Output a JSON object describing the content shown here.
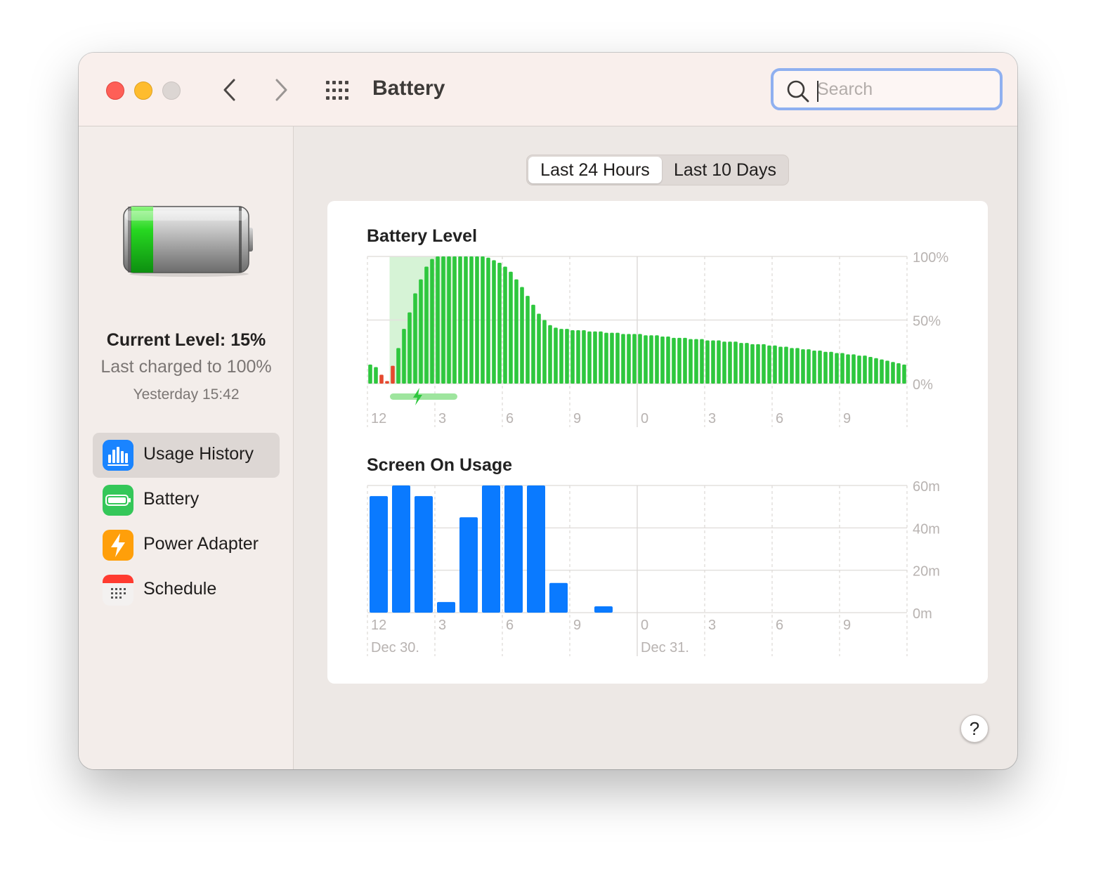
{
  "window": {
    "title": "Battery"
  },
  "search": {
    "placeholder": "Search",
    "value": ""
  },
  "sidebar": {
    "current_level": "Current Level: 15%",
    "last_charged": "Last charged to 100%",
    "charged_time": "Yesterday 15:42",
    "items": [
      {
        "label": "Usage History",
        "icon": "bar-chart-icon",
        "selected": true,
        "color": "#1a7cf5"
      },
      {
        "label": "Battery",
        "icon": "battery-icon",
        "selected": false,
        "color": "#34c759"
      },
      {
        "label": "Power Adapter",
        "icon": "bolt-icon",
        "selected": false,
        "color": "#ff9f0a"
      },
      {
        "label": "Schedule",
        "icon": "calendar-icon",
        "selected": false,
        "color": "#ff3b30"
      }
    ]
  },
  "tabs": [
    {
      "label": "Last 24 Hours",
      "active": true
    },
    {
      "label": "Last 10 Days",
      "active": false
    }
  ],
  "help": {
    "label": "?"
  },
  "chart_data": [
    {
      "type": "bar",
      "title": "Battery Level",
      "ylim": [
        0,
        100
      ],
      "y_ticks": [
        "100%",
        "50%",
        "0%"
      ],
      "y_tick_values": [
        100,
        50,
        0
      ],
      "x_tick_labels": [
        "12",
        "3",
        "6",
        "9",
        "0",
        "3",
        "6",
        "9"
      ],
      "bar_slots": 96,
      "colors": {
        "normal": "#2ec73e",
        "low": "#e5492f",
        "charging_band": "#d6f3d6",
        "charging_bar": "#9ee59e",
        "charging_bolt": "#2ec73e"
      },
      "charging_slots": [
        4,
        15
      ],
      "grid": true,
      "values": [
        15,
        13,
        7,
        2,
        14,
        28,
        43,
        56,
        71,
        82,
        92,
        98,
        100,
        100,
        100,
        100,
        100,
        100,
        100,
        100,
        100,
        99,
        97,
        95,
        92,
        88,
        82,
        76,
        69,
        62,
        55,
        50,
        46,
        44,
        43,
        43,
        42,
        42,
        42,
        41,
        41,
        41,
        40,
        40,
        40,
        39,
        39,
        39,
        39,
        38,
        38,
        38,
        37,
        37,
        36,
        36,
        36,
        35,
        35,
        35,
        34,
        34,
        34,
        33,
        33,
        33,
        32,
        32,
        31,
        31,
        31,
        30,
        30,
        29,
        29,
        28,
        28,
        27,
        27,
        26,
        26,
        25,
        25,
        24,
        24,
        23,
        23,
        22,
        22,
        21,
        20,
        19,
        18,
        17,
        16,
        15
      ],
      "low_flags": [
        0,
        0,
        1,
        1,
        1,
        0,
        0,
        0,
        0,
        0,
        0,
        0,
        0,
        0,
        0,
        0,
        0,
        0,
        0,
        0,
        0,
        0,
        0,
        0,
        0,
        0,
        0,
        0,
        0,
        0,
        0,
        0,
        0,
        0,
        0,
        0,
        0,
        0,
        0,
        0,
        0,
        0,
        0,
        0,
        0,
        0,
        0,
        0,
        0,
        0,
        0,
        0,
        0,
        0,
        0,
        0,
        0,
        0,
        0,
        0,
        0,
        0,
        0,
        0,
        0,
        0,
        0,
        0,
        0,
        0,
        0,
        0,
        0,
        0,
        0,
        0,
        0,
        0,
        0,
        0,
        0,
        0,
        0,
        0,
        0,
        0,
        0,
        0,
        0,
        0,
        0,
        0,
        0,
        0,
        0,
        0,
        0
      ]
    },
    {
      "type": "bar",
      "title": "Screen On Usage",
      "ylim": [
        0,
        60
      ],
      "y_ticks": [
        "60m",
        "40m",
        "20m",
        "0m"
      ],
      "y_tick_values": [
        60,
        40,
        20,
        0
      ],
      "x_tick_labels": [
        "12",
        "3",
        "6",
        "9",
        "0",
        "3",
        "6",
        "9"
      ],
      "date_labels": [
        "Dec 30.",
        "Dec 31."
      ],
      "bar_slots": 24,
      "color": "#0a7aff",
      "grid": true,
      "values": [
        55,
        60,
        55,
        5,
        45,
        60,
        60,
        60,
        14,
        0,
        3,
        0,
        0,
        0,
        0,
        0,
        0,
        0,
        0,
        0,
        0,
        0,
        0,
        0
      ]
    }
  ]
}
